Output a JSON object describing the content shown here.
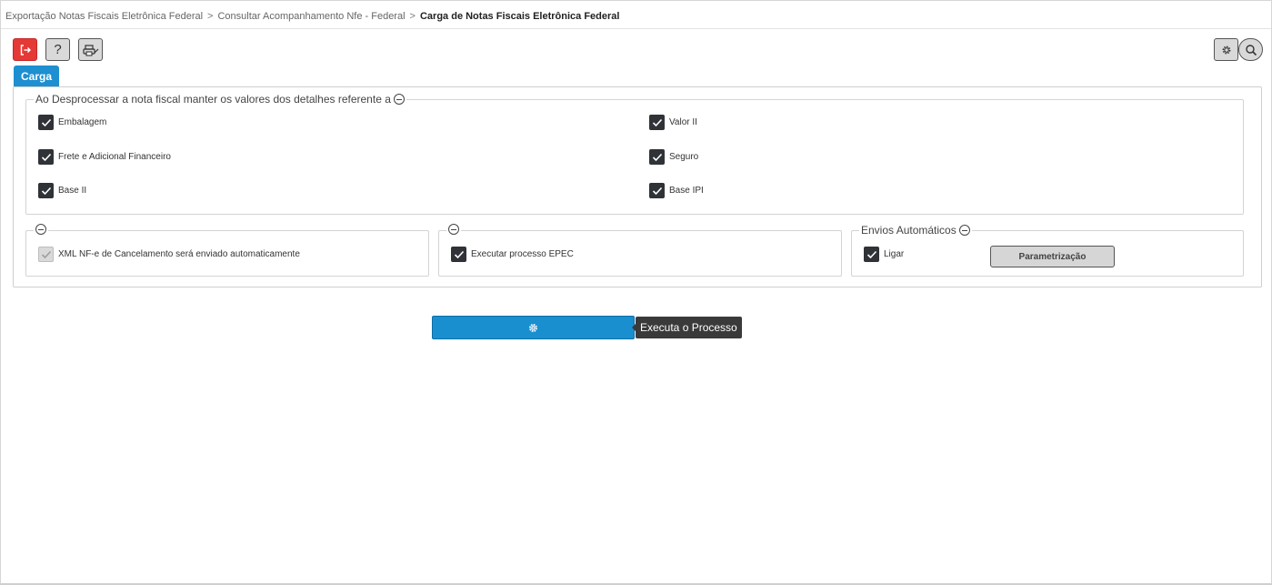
{
  "breadcrumb": {
    "item1": "Exportação Notas Fiscais Eletrônica Federal",
    "item2": "Consultar Acompanhamento Nfe - Federal",
    "current": "Carga de Notas Fiscais Eletrônica Federal",
    "separator": ">"
  },
  "toolbar": {
    "exit_icon": "exit-icon",
    "help_label": "?",
    "print_icon": "printer-icon",
    "settings_icon": "gear-icon",
    "search_icon": "search-icon",
    "exit_color": "#e53935"
  },
  "tabs": [
    {
      "label": "Carga",
      "active": true,
      "color": "#1e8fd0"
    }
  ],
  "details_section": {
    "legend": "Ao Desprocessar a nota fiscal manter os valores dos detalhes referente a",
    "left_items": [
      {
        "label": "Embalagem",
        "checked": true
      },
      {
        "label": "Frete e Adicional Financeiro",
        "checked": true
      },
      {
        "label": "Base II",
        "checked": true
      }
    ],
    "right_items": [
      {
        "label": "Valor II",
        "checked": true
      },
      {
        "label": "Seguro",
        "checked": true
      },
      {
        "label": "Base IPI",
        "checked": true
      }
    ]
  },
  "cancel_section": {
    "item": {
      "label": "XML NF-e de Cancelamento será enviado automaticamente",
      "checked": true,
      "disabled": true
    }
  },
  "epec_section": {
    "item": {
      "label": "Executar processo EPEC",
      "checked": true
    }
  },
  "auto_section": {
    "legend": "Envios Automáticos",
    "item": {
      "label": "Ligar",
      "checked": true
    },
    "button_label": "Parametrização"
  },
  "execute": {
    "icon": "gear-icon",
    "tooltip": "Executa o Processo",
    "color": "#1a8fd0"
  }
}
